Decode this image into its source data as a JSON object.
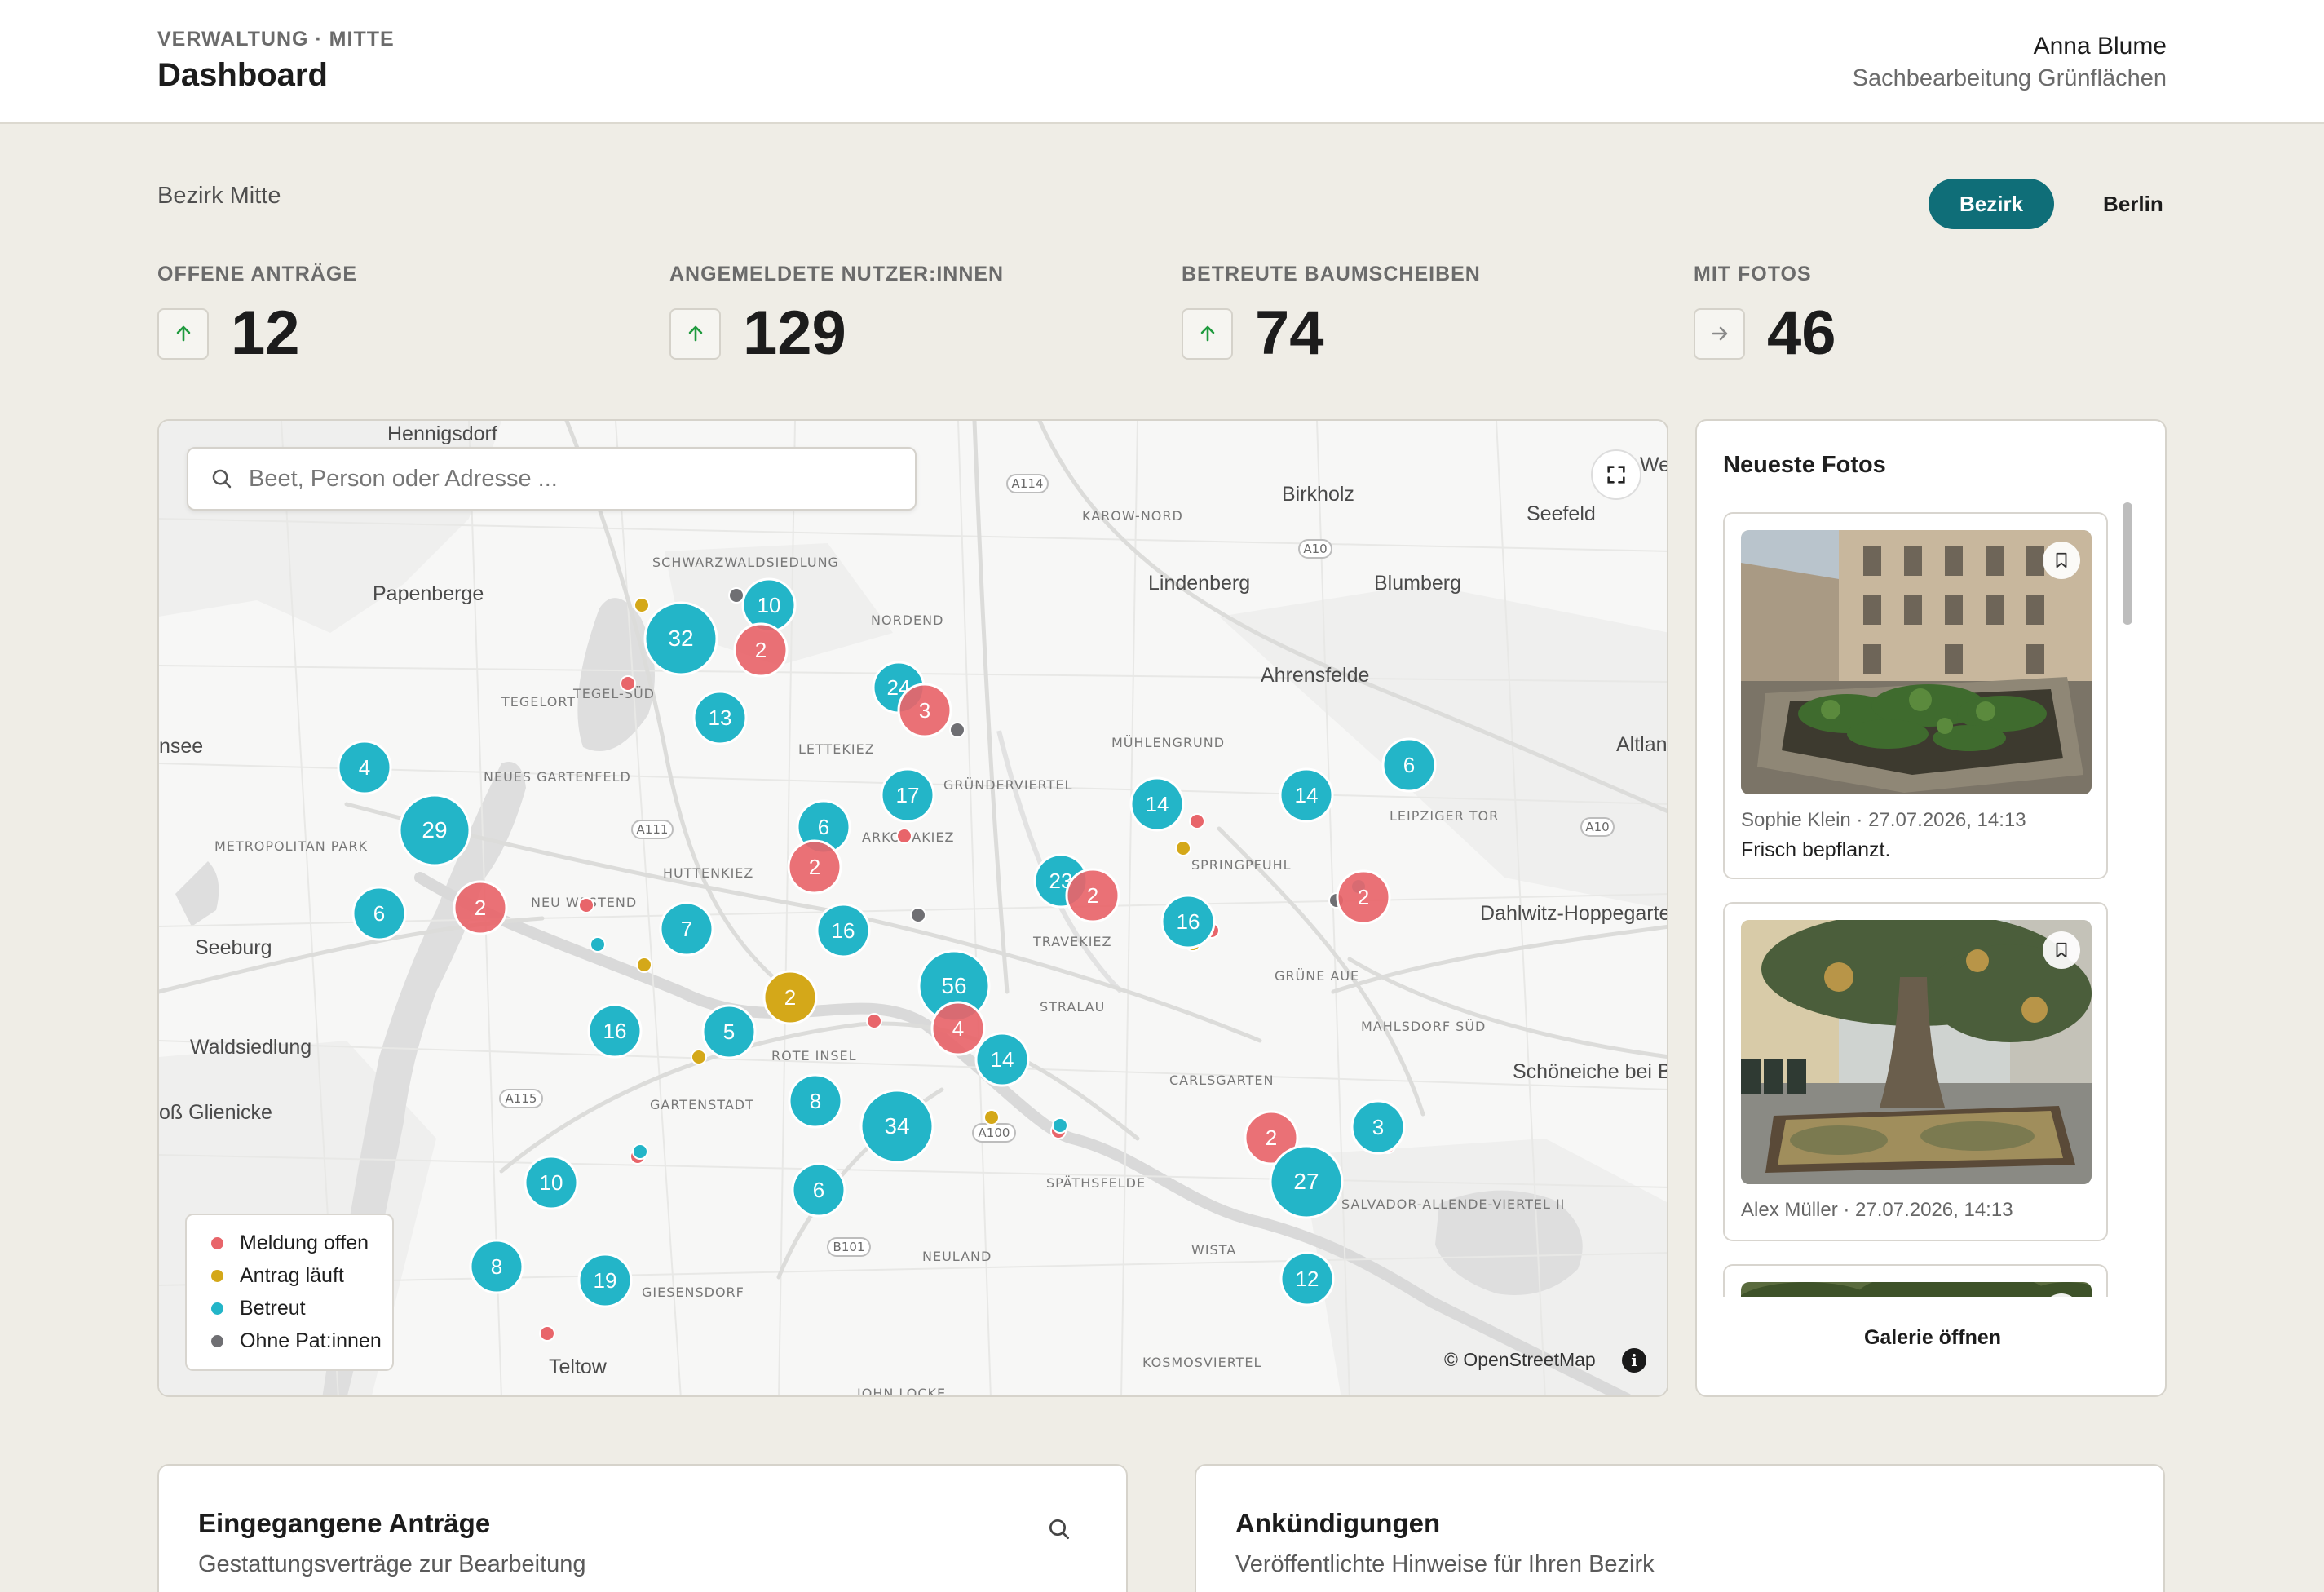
{
  "header": {
    "overline": "VERWALTUNG · MITTE",
    "title": "Dashboard",
    "user_name": "Anna Blume",
    "user_role": "Sachbearbeitung Grünflächen"
  },
  "district_label": "Bezirk Mitte",
  "scope_toggle": {
    "options": [
      "Bezirk",
      "Berlin"
    ],
    "selected": "Bezirk",
    "accent": "#0f6e78"
  },
  "kpis": [
    {
      "label": "OFFENE ANTRÄGE",
      "value": "12",
      "trend": "up"
    },
    {
      "label": "ANGEMELDETE NUTZER:INNEN",
      "value": "129",
      "trend": "up"
    },
    {
      "label": "BETREUTE BAUMSCHEIBEN",
      "value": "74",
      "trend": "up"
    },
    {
      "label": "MIT FOTOS",
      "value": "46",
      "trend": "flat"
    }
  ],
  "map": {
    "search_placeholder": "Beet, Person oder Adresse ...",
    "attribution": "© OpenStreetMap",
    "info_label": "i",
    "place_labels": [
      "Hennigsdorf",
      "Papenberge",
      "Schwarzwaldsiedlung",
      "Nordend",
      "Karow-Nord",
      "Birkholz",
      "Seefeld",
      "Lindenberg",
      "Blumberg",
      "Ahrensfelde",
      "Tegelort",
      "Tegel-Süd",
      "Lettekiez",
      "Neues Gartenfeld",
      "Mühlengrund",
      "Gründerviertel",
      "Leipziger Tor",
      "Altlan",
      "nsee",
      "Metropolitan Park",
      "Arkonakiez",
      "Springpfuhl",
      "Huttenkiez",
      "Neu Westend",
      "Travekiez",
      "Dahlwitz-Hoppegarten",
      "Seeburg",
      "Grüne Aue",
      "Stralau",
      "Mahlsdorf Süd",
      "Waldsiedlung",
      "Rote Insel",
      "Schöneiche bei Be",
      "Carlsgarten",
      "oß Glienicke",
      "Gartenstadt",
      "Späthsfelde",
      "Salvador-Allende-Viertel II",
      "Neuland",
      "Wista",
      "Giesensdorf",
      "Teltow",
      "Kosmosviertel",
      "John Locke",
      "We"
    ],
    "road_labels": [
      "A114",
      "A10",
      "A111",
      "A10",
      "A115",
      "A100",
      "B101"
    ],
    "clusters": [
      {
        "count": "10",
        "status": "betreut"
      },
      {
        "count": "32",
        "status": "betreut"
      },
      {
        "count": "2",
        "status": "meldung"
      },
      {
        "count": "13",
        "status": "betreut"
      },
      {
        "count": "24",
        "status": "betreut"
      },
      {
        "count": "3",
        "status": "meldung"
      },
      {
        "count": "4",
        "status": "betreut"
      },
      {
        "count": "29",
        "status": "betreut"
      },
      {
        "count": "17",
        "status": "betreut"
      },
      {
        "count": "6",
        "status": "betreut"
      },
      {
        "count": "2",
        "status": "meldung"
      },
      {
        "count": "14",
        "status": "betreut"
      },
      {
        "count": "14",
        "status": "betreut"
      },
      {
        "count": "6",
        "status": "betreut"
      },
      {
        "count": "6",
        "status": "betreut"
      },
      {
        "count": "2",
        "status": "meldung"
      },
      {
        "count": "7",
        "status": "betreut"
      },
      {
        "count": "16",
        "status": "betreut"
      },
      {
        "count": "23",
        "status": "betreut"
      },
      {
        "count": "2",
        "status": "meldung"
      },
      {
        "count": "16",
        "status": "betreut"
      },
      {
        "count": "2",
        "status": "meldung"
      },
      {
        "count": "56",
        "status": "betreut"
      },
      {
        "count": "2",
        "status": "antrag"
      },
      {
        "count": "4",
        "status": "meldung"
      },
      {
        "count": "14",
        "status": "betreut"
      },
      {
        "count": "5",
        "status": "betreut"
      },
      {
        "count": "16",
        "status": "betreut"
      },
      {
        "count": "8",
        "status": "betreut"
      },
      {
        "count": "34",
        "status": "betreut"
      },
      {
        "count": "2",
        "status": "meldung"
      },
      {
        "count": "3",
        "status": "betreut"
      },
      {
        "count": "27",
        "status": "betreut"
      },
      {
        "count": "10",
        "status": "betreut"
      },
      {
        "count": "6",
        "status": "betreut"
      },
      {
        "count": "8",
        "status": "betreut"
      },
      {
        "count": "19",
        "status": "betreut"
      },
      {
        "count": "12",
        "status": "betreut"
      }
    ],
    "legend": [
      {
        "label": "Meldung offen",
        "color": "#e8656a"
      },
      {
        "label": "Antrag läuft",
        "color": "#d4a819"
      },
      {
        "label": "Betreut",
        "color": "#23b5c8"
      },
      {
        "label": "Ohne Pat:innen",
        "color": "#6f6f73"
      }
    ]
  },
  "photos": {
    "title": "Neueste Fotos",
    "items": [
      {
        "meta": "Sophie Klein · 27.07.2026, 14:13",
        "caption": "Frisch bepflanzt.",
        "icon": "bookmark-icon"
      },
      {
        "meta": "Alex Müller · 27.07.2026, 14:13",
        "caption": "",
        "icon": "bookmark-icon"
      },
      {
        "meta": "",
        "caption": "",
        "icon": "bookmark-icon"
      }
    ],
    "gallery_button": "Galerie öffnen"
  },
  "panels": [
    {
      "title": "Eingegangene Anträge",
      "subtitle": "Gestattungsverträge zur Bearbeitung",
      "icon": "search-icon"
    },
    {
      "title": "Ankündigungen",
      "subtitle": "Veröffentlichte Hinweise für Ihren Bezirk"
    }
  ],
  "colors": {
    "meldung": "#e8656a",
    "antrag": "#d4a819",
    "betreut": "#23b5c8",
    "ohne": "#6f6f73",
    "trend_up": "#1f9a3e",
    "background": "#efede6"
  }
}
